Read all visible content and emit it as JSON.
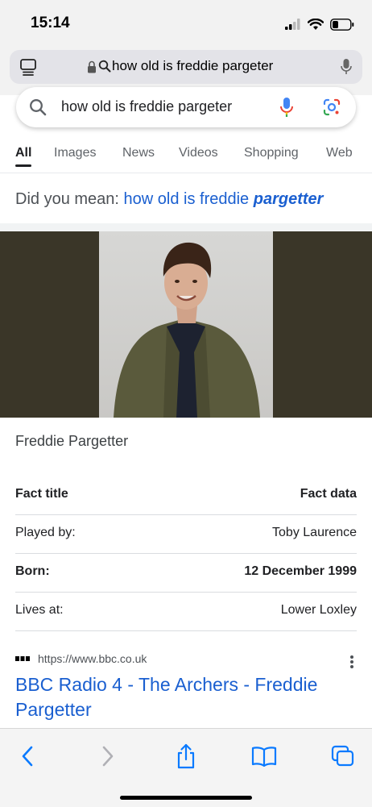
{
  "status_bar": {
    "time": "15:14"
  },
  "address_bar": {
    "url_text": "how old is freddie pargeter"
  },
  "search": {
    "query": "how old is freddie pargeter"
  },
  "tabs": [
    {
      "label": "All",
      "active": true
    },
    {
      "label": "Images",
      "active": false
    },
    {
      "label": "News",
      "active": false
    },
    {
      "label": "Videos",
      "active": false
    },
    {
      "label": "Shopping",
      "active": false
    },
    {
      "label": "Web",
      "active": false
    }
  ],
  "did_you_mean": {
    "prefix": "Did you mean:",
    "suggestion_plain": "how old is freddie",
    "suggestion_emphasis": "pargetter"
  },
  "knowledge_panel": {
    "title": "Freddie Pargetter",
    "facts": [
      {
        "key": "Fact title",
        "value": "Fact data",
        "bold": true
      },
      {
        "key": "Played by:",
        "value": "Toby Laurence",
        "bold": false
      },
      {
        "key": "Born:",
        "value": "12 December 1999",
        "bold": true
      },
      {
        "key": "Lives at:",
        "value": "Lower Loxley",
        "bold": false
      }
    ]
  },
  "result": {
    "url": "https://www.bbc.co.uk",
    "title": "BBC Radio 4 - The Archers - Freddie Pargetter"
  },
  "colors": {
    "link": "#1a5fd0",
    "image_band": "#3a3628",
    "toolbar_icons": "#0a7aff"
  }
}
